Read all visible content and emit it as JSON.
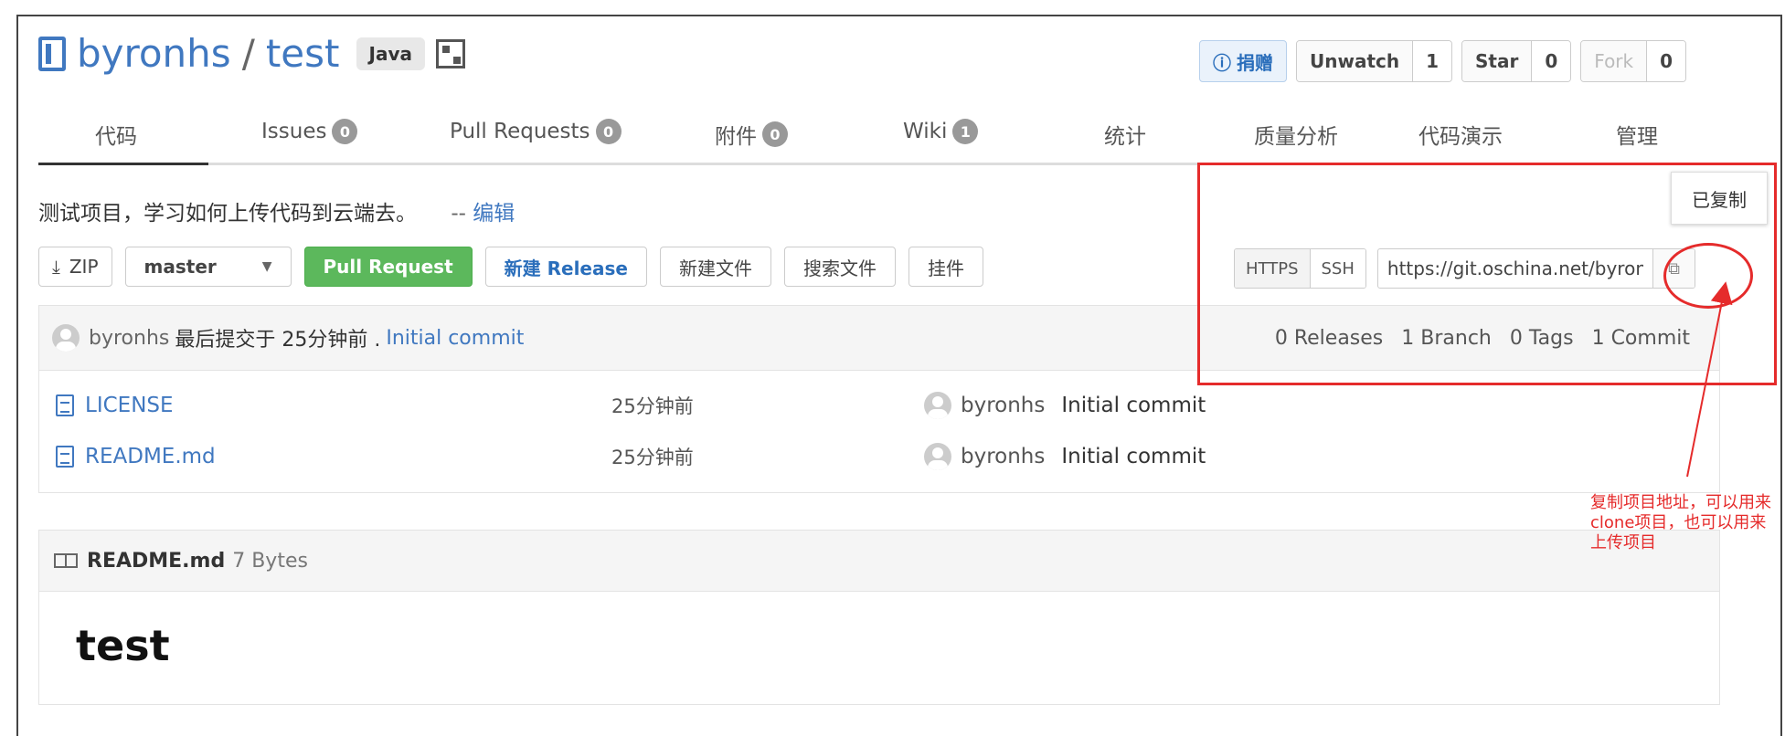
{
  "repo": {
    "owner": "byronhs",
    "separator": "/",
    "name": "test",
    "language": "Java"
  },
  "header_buttons": {
    "donate": "捐赠",
    "watch": {
      "label": "Unwatch",
      "count": "1"
    },
    "star": {
      "label": "Star",
      "count": "0"
    },
    "fork": {
      "label": "Fork",
      "count": "0"
    }
  },
  "tabs": [
    {
      "label": "代码"
    },
    {
      "label": "Issues",
      "count": "0"
    },
    {
      "label": "Pull Requests",
      "count": "0"
    },
    {
      "label": "附件",
      "count": "0"
    },
    {
      "label": "Wiki",
      "count": "1"
    },
    {
      "label": "统计"
    },
    {
      "label": "质量分析"
    },
    {
      "label": "代码演示"
    },
    {
      "label": "管理"
    }
  ],
  "description": {
    "text": "测试项目，学习如何上传代码到云端去。",
    "dash": "--",
    "edit": "编辑"
  },
  "toolbar": {
    "zip": "ZIP",
    "branch": "master",
    "pull_request": "Pull Request",
    "new_release": "新建 Release",
    "new_file": "新建文件",
    "search_file": "搜索文件",
    "widget": "挂件"
  },
  "clone": {
    "https": "HTTPS",
    "ssh": "SSH",
    "url": "https://git.oschina.net/byronhs/test.git",
    "copied_tooltip": "已复制"
  },
  "last_commit": {
    "author": "byronhs",
    "text": "最后提交于 25分钟前 .",
    "message": "Initial commit",
    "releases": "0 Releases",
    "branches": "1 Branch",
    "tags": "0 Tags",
    "commits": "1 Commit"
  },
  "files": [
    {
      "name": "LICENSE",
      "time": "25分钟前",
      "author": "byronhs",
      "message": "Initial commit"
    },
    {
      "name": "README.md",
      "time": "25分钟前",
      "author": "byronhs",
      "message": "Initial commit"
    }
  ],
  "readme": {
    "filename": "README.md",
    "size": "7 Bytes",
    "heading": "test"
  },
  "annotation": {
    "note": "复制项目地址，可以用来clone项目，也可以用来上传项目",
    "color": "#e52b2b"
  },
  "colors": {
    "link": "#4078c0",
    "primary_green": "#5cb85c"
  }
}
